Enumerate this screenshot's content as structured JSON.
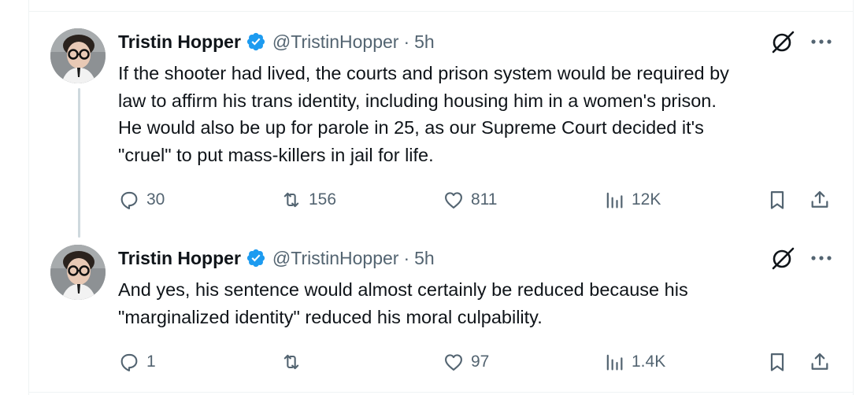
{
  "tweets": [
    {
      "author_name": "Tristin Hopper",
      "handle": "@TristinHopper",
      "separator": "·",
      "time": "5h",
      "lines": [
        "If the shooter had lived, the courts and prison system would be required by",
        "law to affirm his trans identity, including housing him in a women's prison.",
        "He would also be up for parole in 25, as our Supreme Court decided it's",
        "\"cruel\" to put mass-killers in jail for life."
      ],
      "replies": "30",
      "reposts": "156",
      "likes": "811",
      "views": "12K"
    },
    {
      "author_name": "Tristin Hopper",
      "handle": "@TristinHopper",
      "separator": "·",
      "time": "5h",
      "lines": [
        "And yes, his sentence would almost certainly be reduced because his",
        "\"marginalized identity\" reduced his moral culpability."
      ],
      "replies": "1",
      "reposts": "",
      "likes": "97",
      "views": "1.4K"
    }
  ],
  "icons": {
    "reply": "reply-icon",
    "repost": "repost-icon",
    "like": "like-icon",
    "views": "views-icon",
    "bookmark": "bookmark-icon",
    "share": "share-icon",
    "grok": "grok-icon",
    "more": "more-icon",
    "verified": "verified-badge-icon"
  },
  "colors": {
    "text": "#0f1419",
    "secondary": "#536471",
    "verified": "#1d9bf0",
    "thread_line": "#cfd9de",
    "divider": "#eff3f4"
  }
}
